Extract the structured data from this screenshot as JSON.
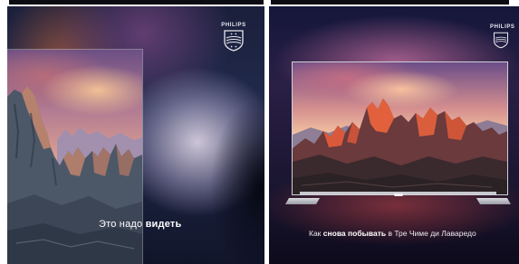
{
  "panels": {
    "left": {
      "brand": "PHILIPS",
      "caption_plain": "Это надо ",
      "caption_bold": "видеть"
    },
    "right": {
      "brand": "PHILIPS",
      "caption_pre": "Как ",
      "caption_bold": "снова побывать",
      "caption_post": " в Тре Чиме ди Лаваредо"
    }
  },
  "icons": {
    "logo": "philips-shield-icon"
  },
  "colors": {
    "background": "#1a1f3b",
    "caption": "#ffffff"
  }
}
